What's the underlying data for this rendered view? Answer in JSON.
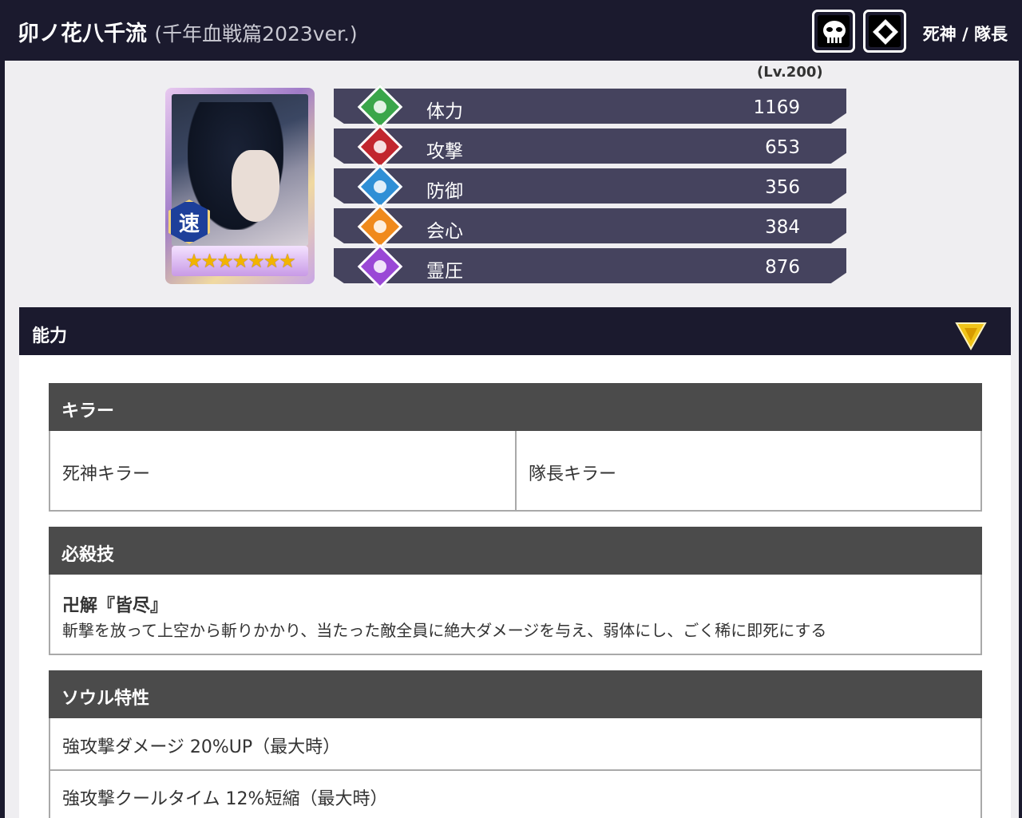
{
  "header": {
    "name": "卯ノ花八千流",
    "version": "(千年血戦篇2023ver.)",
    "classes": "死神 / 隊長",
    "icons": [
      "hollow-mask-icon",
      "diamond-attribute-icon"
    ]
  },
  "portrait": {
    "badge": "速",
    "rarity_stars": 7,
    "stars_text": "★★★★★★★"
  },
  "stats": {
    "level_label": "(Lv.200)",
    "rows": [
      {
        "label": "体力",
        "value": "1169",
        "color": "#3aa64a"
      },
      {
        "label": "攻撃",
        "value": "653",
        "color": "#c2262e"
      },
      {
        "label": "防御",
        "value": "356",
        "color": "#2f8fd6"
      },
      {
        "label": "会心",
        "value": "384",
        "color": "#f08a1c"
      },
      {
        "label": "霊圧",
        "value": "876",
        "color": "#9a48d6"
      }
    ]
  },
  "abilities": {
    "title": "能力",
    "killer": {
      "heading": "キラー",
      "items": [
        "死神キラー",
        "隊長キラー"
      ]
    },
    "special": {
      "heading": "必殺技",
      "name": "卍解『皆尽』",
      "desc": "斬撃を放って上空から斬りかかり、当たった敵全員に絶大ダメージを与え、弱体にし、ごく稀に即死にする"
    },
    "soul": {
      "heading": "ソウル特性",
      "items": [
        "強攻撃ダメージ 20%UP（最大時）",
        "強攻撃クールタイム 12%短縮（最大時）"
      ]
    }
  }
}
